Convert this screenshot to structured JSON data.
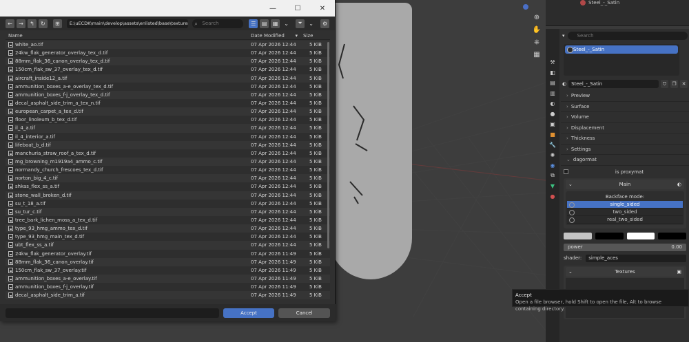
{
  "file_browser": {
    "window_buttons": {
      "minimize": "—",
      "maximize": "☐",
      "close": "✕"
    },
    "path": "E:\\uECDK\\main\\develop\\assets\\enlisted\\base\\textures\\",
    "search_placeholder": "Search",
    "columns": {
      "name": "Name",
      "date": "Date Modified",
      "size": "Size"
    },
    "files": [
      {
        "name": "white_ao.tif",
        "date": "07 Apr 2026 12:44",
        "size": "5 KiB"
      },
      {
        "name": "24kw_flak_generator_overlay_tex_d.tif",
        "date": "07 Apr 2026 12:44",
        "size": "5 KiB"
      },
      {
        "name": "88mm_flak_36_canon_overlay_tex_d.tif",
        "date": "07 Apr 2026 12:44",
        "size": "5 KiB"
      },
      {
        "name": "150cm_flak_sw_37_overlay_tex_d.tif",
        "date": "07 Apr 2026 12:44",
        "size": "5 KiB"
      },
      {
        "name": "aircraft_inside12_a.tif",
        "date": "07 Apr 2026 12:44",
        "size": "5 KiB"
      },
      {
        "name": "ammunition_boxes_a-e_overlay_tex_d.tif",
        "date": "07 Apr 2026 12:44",
        "size": "5 KiB"
      },
      {
        "name": "ammunition_boxes_f-j_overlay_tex_d.tif",
        "date": "07 Apr 2026 12:44",
        "size": "5 KiB"
      },
      {
        "name": "decal_asphalt_side_trim_a_tex_n.tif",
        "date": "07 Apr 2026 12:44",
        "size": "5 KiB"
      },
      {
        "name": "european_carpet_a_tex_d.tif",
        "date": "07 Apr 2026 12:44",
        "size": "5 KiB"
      },
      {
        "name": "floor_linoleum_b_tex_d.tif",
        "date": "07 Apr 2026 12:44",
        "size": "5 KiB"
      },
      {
        "name": "il_4_a.tif",
        "date": "07 Apr 2026 12:44",
        "size": "5 KiB"
      },
      {
        "name": "il_4_interior_a.tif",
        "date": "07 Apr 2026 12:44",
        "size": "5 KiB"
      },
      {
        "name": "lifeboat_b_d.tif",
        "date": "07 Apr 2026 12:44",
        "size": "5 KiB"
      },
      {
        "name": "manchuria_straw_roof_a_tex_d.tif",
        "date": "07 Apr 2026 12:44",
        "size": "5 KiB"
      },
      {
        "name": "mg_browning_m1919a4_ammo_c.tif",
        "date": "07 Apr 2026 12:44",
        "size": "5 KiB"
      },
      {
        "name": "normandy_church_frescoes_tex_d.tif",
        "date": "07 Apr 2026 12:44",
        "size": "5 KiB"
      },
      {
        "name": "norton_big_4_c.tif",
        "date": "07 Apr 2026 12:44",
        "size": "5 KiB"
      },
      {
        "name": "shkas_flex_ss_a.tif",
        "date": "07 Apr 2026 12:44",
        "size": "5 KiB"
      },
      {
        "name": "stone_wall_broken_d.tif",
        "date": "07 Apr 2026 12:44",
        "size": "5 KiB"
      },
      {
        "name": "su_t_18_a.tif",
        "date": "07 Apr 2026 12:44",
        "size": "5 KiB"
      },
      {
        "name": "su_tur_c.tif",
        "date": "07 Apr 2026 12:44",
        "size": "5 KiB"
      },
      {
        "name": "tree_bark_lichen_moss_a_tex_d.tif",
        "date": "07 Apr 2026 12:44",
        "size": "5 KiB"
      },
      {
        "name": "type_93_hmg_ammo_tex_d.tif",
        "date": "07 Apr 2026 12:44",
        "size": "5 KiB"
      },
      {
        "name": "type_93_hmg_main_tex_d.tif",
        "date": "07 Apr 2026 12:44",
        "size": "5 KiB"
      },
      {
        "name": "ubt_flex_ss_a.tif",
        "date": "07 Apr 2026 12:44",
        "size": "5 KiB"
      },
      {
        "name": "24kw_flak_generator_overlay.tif",
        "date": "07 Apr 2026 11:49",
        "size": "5 KiB"
      },
      {
        "name": "88mm_flak_36_canon_overlay.tif",
        "date": "07 Apr 2026 11:49",
        "size": "5 KiB"
      },
      {
        "name": "150cm_flak_sw_37_overlay.tif",
        "date": "07 Apr 2026 11:49",
        "size": "5 KiB"
      },
      {
        "name": "ammunition_boxes_a-e_overlay.tif",
        "date": "07 Apr 2026 11:49",
        "size": "5 KiB"
      },
      {
        "name": "ammunition_boxes_f-j_overlay.tif",
        "date": "07 Apr 2026 11:49",
        "size": "5 KiB"
      },
      {
        "name": "decal_asphalt_side_trim_a.tif",
        "date": "07 Apr 2026 11:49",
        "size": "5 KiB"
      }
    ],
    "accept_label": "Accept",
    "cancel_label": "Cancel"
  },
  "outliner": {
    "object_label": "Steel_-_Satin"
  },
  "properties": {
    "search_placeholder": "Search",
    "slot_name": "Steel_-_Satin",
    "material_name": "Steel_-_Satin",
    "sections": [
      "Preview",
      "Surface",
      "Volume",
      "Displacement",
      "Thickness",
      "Settings",
      "dagormat"
    ],
    "is_proxymat_label": "is proxymat",
    "main_label": "Main",
    "backface_label": "Backface mode:",
    "backface_options": [
      "single_sided",
      "two_sided",
      "real_two_sided"
    ],
    "power_label": "power",
    "power_value": "0.00",
    "shader_label": "shader:",
    "shader_value": "simple_aces",
    "textures_label": "Textures",
    "swatch_colors": [
      "#c4c4c4",
      "#000000",
      "#ffffff",
      "#000000"
    ],
    "accent": "#4672c4"
  },
  "tooltip": {
    "title": "Accept",
    "body": "Open a file browser, hold Shift to open the file, Alt to browse containing directory."
  }
}
